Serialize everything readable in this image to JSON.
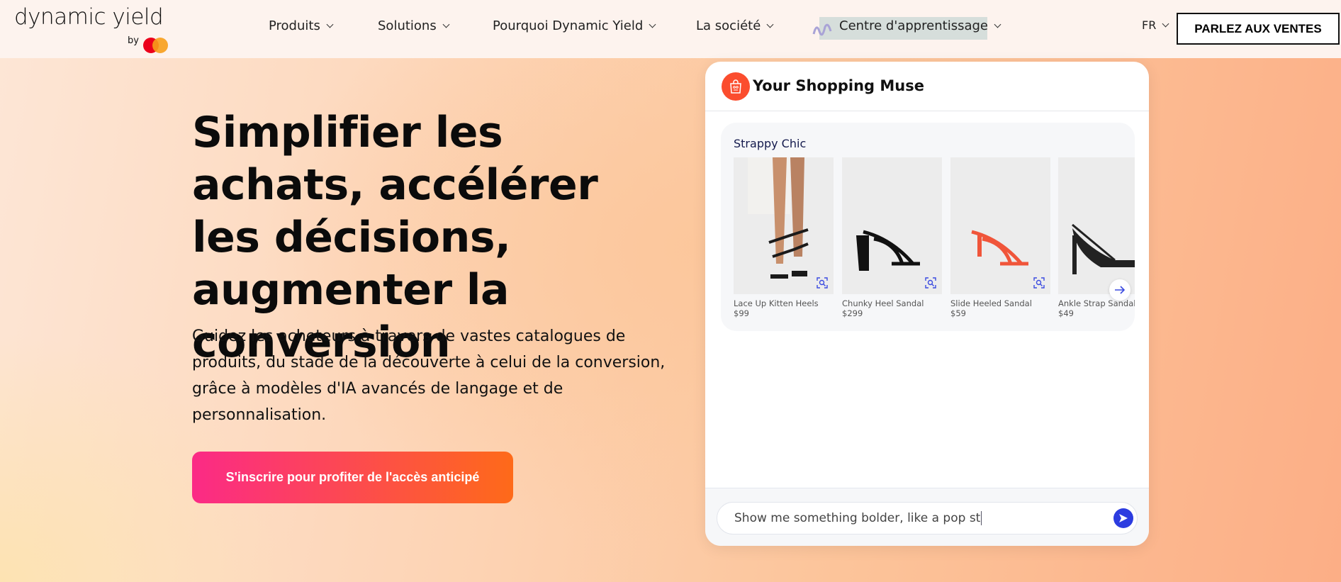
{
  "nav": {
    "logo_text": "dynamic yield",
    "logo_by": "by",
    "items": [
      {
        "label": "Produits"
      },
      {
        "label": "Solutions"
      },
      {
        "label": "Pourquoi Dynamic Yield"
      },
      {
        "label": "La société"
      },
      {
        "label": "Centre d'apprentissage"
      }
    ],
    "language": "FR",
    "cta_label": "PARLEZ AUX VENTES"
  },
  "hero": {
    "title": "Simplifier les achats, accélérer les décisions, augmenter la conversion",
    "description": "Guidez les acheteurs à travers de vastes catalogues de produits, du stade de la découverte à celui de la conversion, grâce à modèles d'IA avancés de langage et de personnalisation.",
    "signup_label": "S'inscrire pour profiter de l'accès anticipé"
  },
  "chat": {
    "title": "Your Shopping Muse",
    "collection_title": "Strappy Chic",
    "products": [
      {
        "name": "Lace Up Kitten Heels",
        "price": "$99",
        "color": "#1a1a1a"
      },
      {
        "name": "Chunky Heel Sandal",
        "price": "$299",
        "color": "#111111"
      },
      {
        "name": "Slide Heeled Sandal",
        "price": "$59",
        "color": "#f0553a"
      },
      {
        "name": "Ankle Strap Sandal",
        "price": "$49",
        "color": "#222222"
      }
    ],
    "input_value": "Show me something bolder, like a pop st",
    "accent_color": "#2c3ce0"
  }
}
